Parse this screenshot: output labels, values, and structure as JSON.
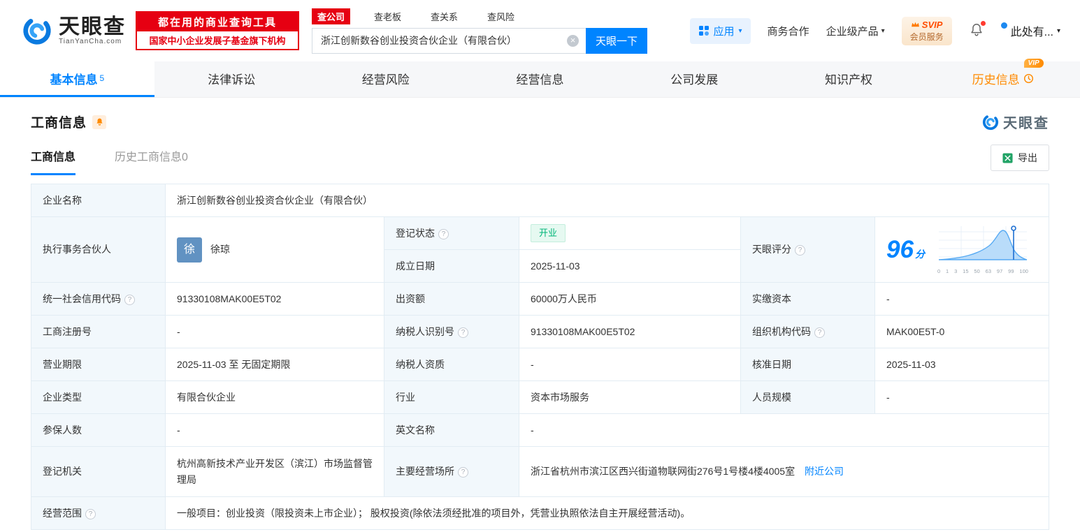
{
  "header": {
    "brand": {
      "name": "天眼查",
      "domain": "TianYanCha.com"
    },
    "slogan": {
      "line1": "都在用的商业查询工具",
      "line2": "国家中小企业发展子基金旗下机构"
    },
    "search": {
      "tabs": [
        {
          "label": "查公司"
        },
        {
          "label": "查老板"
        },
        {
          "label": "查关系"
        },
        {
          "label": "查风险"
        }
      ],
      "value": "浙江创新数谷创业投资合伙企业（有限合伙）",
      "button": "天眼一下"
    },
    "apps_label": "应用",
    "link_cooperation": "商务合作",
    "link_enterprise": "企业级产品",
    "vip": {
      "line1": "SVIP",
      "line2": "会员服务"
    },
    "user_label": "此处有..."
  },
  "nav_tabs": [
    {
      "label": "基本信息",
      "badge": "5"
    },
    {
      "label": "法律诉讼"
    },
    {
      "label": "经营风险"
    },
    {
      "label": "经营信息"
    },
    {
      "label": "公司发展"
    },
    {
      "label": "知识产权"
    },
    {
      "label": "历史信息",
      "vip_tag": "VIP"
    }
  ],
  "section": {
    "title": "工商信息",
    "watermark": "天眼查",
    "sub_tabs": [
      {
        "label": "工商信息"
      },
      {
        "label": "历史工商信息",
        "count": "0"
      }
    ],
    "export_label": "导出"
  },
  "info": {
    "company_name": {
      "label": "企业名称",
      "value": "浙江创新数谷创业投资合伙企业（有限合伙）"
    },
    "partner": {
      "label": "执行事务合伙人",
      "avatar": "徐",
      "name": "徐琼"
    },
    "reg_status": {
      "label": "登记状态",
      "value": "开业"
    },
    "score": {
      "label": "天眼评分",
      "value": "96",
      "unit": "分",
      "axis_ticks": [
        "0",
        "1",
        "3",
        "15",
        "50",
        "63",
        "97",
        "99",
        "100"
      ]
    },
    "established": {
      "label": "成立日期",
      "value": "2025-11-03"
    },
    "credit_code": {
      "label": "统一社会信用代码",
      "value": "91330108MAK00E5T02"
    },
    "capital": {
      "label": "出资额",
      "value": "60000万人民币"
    },
    "paid_in_capital": {
      "label": "实缴资本",
      "value": "-"
    },
    "reg_number": {
      "label": "工商注册号",
      "value": "-"
    },
    "taxpayer_id": {
      "label": "纳税人识别号",
      "value": "91330108MAK00E5T02"
    },
    "org_code": {
      "label": "组织机构代码",
      "value": "MAK00E5T-0"
    },
    "business_term": {
      "label": "营业期限",
      "value": "2025-11-03 至 无固定期限"
    },
    "taxpayer_qualification": {
      "label": "纳税人资质",
      "value": "-"
    },
    "approval_date": {
      "label": "核准日期",
      "value": "2025-11-03"
    },
    "company_type": {
      "label": "企业类型",
      "value": "有限合伙企业"
    },
    "industry": {
      "label": "行业",
      "value": "资本市场服务"
    },
    "staff_size": {
      "label": "人员规模",
      "value": "-"
    },
    "insured_count": {
      "label": "参保人数",
      "value": "-"
    },
    "english_name": {
      "label": "英文名称",
      "value": "-"
    },
    "registry": {
      "label": "登记机关",
      "value": "杭州高新技术产业开发区（滨江）市场监督管理局"
    },
    "address": {
      "label": "主要经营场所",
      "value": "浙江省杭州市滨江区西兴街道物联网街276号1号楼4楼4005室",
      "link": "附近公司"
    },
    "scope": {
      "label": "经营范围",
      "value": "一般项目：创业投资（限投资未上市企业）； 股权投资(除依法须经批准的项目外，凭营业执照依法自主开展经营活动)。"
    }
  },
  "colors": {
    "accent_blue": "#0084ff",
    "brand_red": "#e60012",
    "status_green": "#00b578",
    "vip_orange": "#ff8a00"
  }
}
